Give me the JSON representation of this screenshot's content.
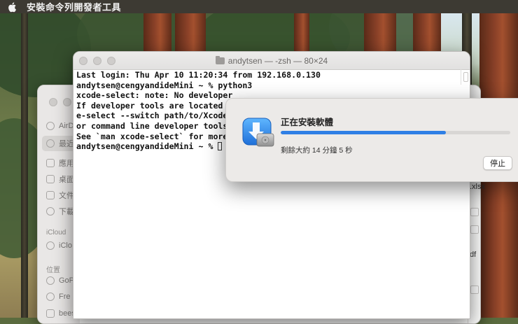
{
  "menubar": {
    "app_name": "安裝命令列開發者工具"
  },
  "terminal": {
    "title": "andytsen — -zsh — 80×24",
    "lines": [
      "Last login: Thu Apr 10 11:20:34 from 192.168.0.130",
      "andytsen@cengyandideMini ~ % python3",
      "xcode-select: note: No developer",
      "If developer tools are located a",
      "e-select --switch path/to/Xcode",
      "or command line developer tools",
      "See `man xcode-select` for more",
      "andytsen@cengyandideMini ~ % "
    ]
  },
  "installer": {
    "title": "正在安裝軟體",
    "progress": 0.72,
    "status": "剩餘大約 14 分鐘 5 秒",
    "stop_label": "停止"
  },
  "finder": {
    "sidebar": {
      "airdrop": "AirD",
      "recents": "最近",
      "applications": "應用",
      "desktop": "桌面",
      "documents": "文件",
      "downloads": "下載",
      "icloud_header": "iCloud",
      "icloud_drive": "iClo",
      "locations_header": "位置",
      "loc1": "GoP",
      "loc2": "Fre",
      "loc3": "beestation"
    },
    "files": {
      "xlsx": ".xlsx",
      "pdf": "df"
    }
  },
  "colors": {
    "accent": "#2f7fe5",
    "menubar": "#3d3a33"
  }
}
